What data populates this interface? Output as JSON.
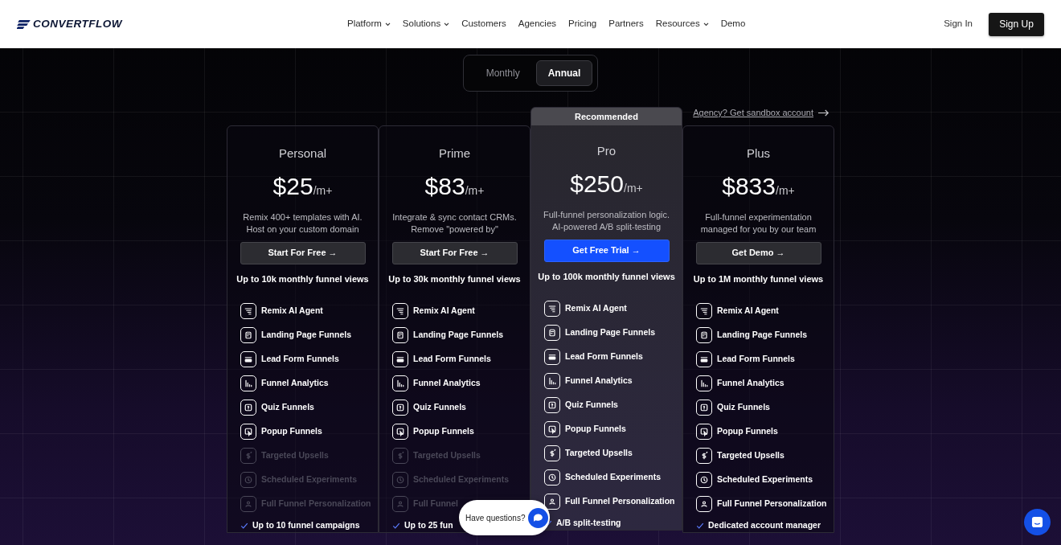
{
  "brand": {
    "name": "CONVERTFLOW"
  },
  "nav": [
    {
      "label": "Platform",
      "has_menu": true
    },
    {
      "label": "Solutions",
      "has_menu": true
    },
    {
      "label": "Customers",
      "has_menu": false
    },
    {
      "label": "Agencies",
      "has_menu": false
    },
    {
      "label": "Pricing",
      "has_menu": false
    },
    {
      "label": "Partners",
      "has_menu": false
    },
    {
      "label": "Resources",
      "has_menu": true
    },
    {
      "label": "Demo",
      "has_menu": false
    }
  ],
  "sign_in": "Sign In",
  "sign_up": "Sign Up",
  "billing_toggle": [
    {
      "label": "Monthly",
      "selected": false
    },
    {
      "label": "Annual",
      "selected": true
    }
  ],
  "agency_link": "Agency? Get sandbox account",
  "plans": [
    {
      "name": "Personal",
      "price": "$25",
      "unit": "/m+",
      "description": [
        "Remix 400+ templates with AI.",
        "Host on your custom domain"
      ],
      "cta": "Start For Free →",
      "recommended": false,
      "views": "Up to 10k monthly funnel views",
      "features": [
        {
          "label": "Remix AI Agent",
          "included": true
        },
        {
          "label": "Landing Page Funnels",
          "included": true
        },
        {
          "label": "Lead Form Funnels",
          "included": true
        },
        {
          "label": "Funnel Analytics",
          "included": true
        },
        {
          "label": "Quiz Funnels",
          "included": true
        },
        {
          "label": "Popup Funnels",
          "included": true
        },
        {
          "label": "Targeted Upsells",
          "included": false
        },
        {
          "label": "Scheduled Experiments",
          "included": false
        },
        {
          "label": "Full Funnel Personalization",
          "included": false
        }
      ],
      "extras": [
        "Up to 10 funnel campaigns"
      ]
    },
    {
      "name": "Prime",
      "price": "$83",
      "unit": "/m+",
      "description": [
        "Integrate & sync contact CRMs.",
        "Remove \"powered by\""
      ],
      "cta": "Start For Free →",
      "recommended": false,
      "views": "Up to 30k monthly funnel views",
      "features": [
        {
          "label": "Remix AI Agent",
          "included": true
        },
        {
          "label": "Landing Page Funnels",
          "included": true
        },
        {
          "label": "Lead Form Funnels",
          "included": true
        },
        {
          "label": "Funnel Analytics",
          "included": true
        },
        {
          "label": "Quiz Funnels",
          "included": true
        },
        {
          "label": "Popup Funnels",
          "included": true
        },
        {
          "label": "Targeted Upsells",
          "included": false
        },
        {
          "label": "Scheduled Experiments",
          "included": false
        },
        {
          "label": "Full Funnel",
          "included": false
        }
      ],
      "extras": [
        "Up to 25 fun"
      ]
    },
    {
      "name": "Pro",
      "price": "$250",
      "unit": "/m+",
      "description": [
        "Full-funnel personalization logic.",
        "AI-powered A/B split-testing"
      ],
      "cta": "Get Free Trial →",
      "recommended": true,
      "badge": "Recommended",
      "views": "Up to 100k monthly funnel views",
      "features": [
        {
          "label": "Remix AI Agent",
          "included": true
        },
        {
          "label": "Landing Page Funnels",
          "included": true
        },
        {
          "label": "Lead Form Funnels",
          "included": true
        },
        {
          "label": "Funnel Analytics",
          "included": true
        },
        {
          "label": "Quiz Funnels",
          "included": true
        },
        {
          "label": "Popup Funnels",
          "included": true
        },
        {
          "label": "Targeted Upsells",
          "included": true
        },
        {
          "label": "Scheduled Experiments",
          "included": true
        },
        {
          "label": "Full Funnel Personalization",
          "included": true
        }
      ],
      "extras": [
        "A/B split-testing"
      ]
    },
    {
      "name": "Plus",
      "price": "$833",
      "unit": "/m+",
      "description": [
        "Full-funnel experimentation",
        "managed for you by our team"
      ],
      "cta": "Get Demo →",
      "recommended": false,
      "views": "Up to 1M monthly funnel views",
      "features": [
        {
          "label": "Remix AI Agent",
          "included": true
        },
        {
          "label": "Landing Page Funnels",
          "included": true
        },
        {
          "label": "Lead Form Funnels",
          "included": true
        },
        {
          "label": "Funnel Analytics",
          "included": true
        },
        {
          "label": "Quiz Funnels",
          "included": true
        },
        {
          "label": "Popup Funnels",
          "included": true
        },
        {
          "label": "Targeted Upsells",
          "included": true
        },
        {
          "label": "Scheduled Experiments",
          "included": true
        },
        {
          "label": "Full Funnel Personalization",
          "included": true
        }
      ],
      "extras": [
        "Dedicated account manager"
      ]
    }
  ],
  "chat_prompt": "Have questions?"
}
